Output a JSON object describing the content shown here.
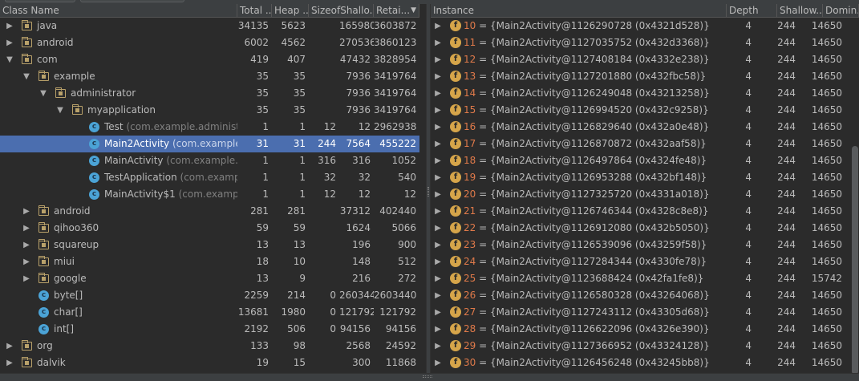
{
  "class_table": {
    "columns": [
      "Class Name",
      "Total ...",
      "Heap ...",
      "SizeofShallo...",
      "Retai..."
    ],
    "rows": [
      {
        "name": "java",
        "pkg": "",
        "kind": "package",
        "depth": 0,
        "expanded": false,
        "total": "34135",
        "heap": "5623",
        "sizeof": "",
        "shallow": "165980",
        "retained": "3603872",
        "selected": false
      },
      {
        "name": "android",
        "pkg": "",
        "kind": "package",
        "depth": 0,
        "expanded": false,
        "total": "6002",
        "heap": "4562",
        "sizeof": "",
        "shallow": "270536",
        "retained": "3860123",
        "selected": false
      },
      {
        "name": "com",
        "pkg": "",
        "kind": "package",
        "depth": 0,
        "expanded": true,
        "total": "419",
        "heap": "407",
        "sizeof": "",
        "shallow": "47432",
        "retained": "3828954",
        "selected": false
      },
      {
        "name": "example",
        "pkg": "",
        "kind": "package",
        "depth": 1,
        "expanded": true,
        "total": "35",
        "heap": "35",
        "sizeof": "",
        "shallow": "7936",
        "retained": "3419764",
        "selected": false
      },
      {
        "name": "administrator",
        "pkg": "",
        "kind": "package",
        "depth": 2,
        "expanded": true,
        "total": "35",
        "heap": "35",
        "sizeof": "",
        "shallow": "7936",
        "retained": "3419764",
        "selected": false
      },
      {
        "name": "myapplication",
        "pkg": "",
        "kind": "package",
        "depth": 3,
        "expanded": true,
        "total": "35",
        "heap": "35",
        "sizeof": "",
        "shallow": "7936",
        "retained": "3419764",
        "selected": false
      },
      {
        "name": "Test",
        "pkg": "(com.example.administra",
        "kind": "class",
        "depth": 4,
        "expanded": null,
        "total": "1",
        "heap": "1",
        "sizeof": "12",
        "shallow": "12",
        "retained": "2962938",
        "selected": false
      },
      {
        "name": "Main2Activity",
        "pkg": "(com.example.a",
        "kind": "class",
        "depth": 4,
        "expanded": null,
        "total": "31",
        "heap": "31",
        "sizeof": "244",
        "shallow": "7564",
        "retained": "455222",
        "selected": true
      },
      {
        "name": "MainActivity",
        "pkg": "(com.example.ac",
        "kind": "class",
        "depth": 4,
        "expanded": null,
        "total": "1",
        "heap": "1",
        "sizeof": "316",
        "shallow": "316",
        "retained": "1052",
        "selected": false
      },
      {
        "name": "TestApplication",
        "pkg": "(com.exampl",
        "kind": "class",
        "depth": 4,
        "expanded": null,
        "total": "1",
        "heap": "1",
        "sizeof": "32",
        "shallow": "32",
        "retained": "540",
        "selected": false
      },
      {
        "name": "MainActivity$1",
        "pkg": "(com.example",
        "kind": "class",
        "depth": 4,
        "expanded": null,
        "total": "1",
        "heap": "1",
        "sizeof": "12",
        "shallow": "12",
        "retained": "12",
        "selected": false
      },
      {
        "name": "android",
        "pkg": "",
        "kind": "package",
        "depth": 1,
        "expanded": false,
        "total": "281",
        "heap": "281",
        "sizeof": "",
        "shallow": "37312",
        "retained": "402440",
        "selected": false
      },
      {
        "name": "qihoo360",
        "pkg": "",
        "kind": "package",
        "depth": 1,
        "expanded": false,
        "total": "59",
        "heap": "59",
        "sizeof": "",
        "shallow": "1624",
        "retained": "5066",
        "selected": false
      },
      {
        "name": "squareup",
        "pkg": "",
        "kind": "package",
        "depth": 1,
        "expanded": false,
        "total": "13",
        "heap": "13",
        "sizeof": "",
        "shallow": "196",
        "retained": "900",
        "selected": false
      },
      {
        "name": "miui",
        "pkg": "",
        "kind": "package",
        "depth": 1,
        "expanded": false,
        "total": "18",
        "heap": "10",
        "sizeof": "",
        "shallow": "148",
        "retained": "512",
        "selected": false
      },
      {
        "name": "google",
        "pkg": "",
        "kind": "package",
        "depth": 1,
        "expanded": false,
        "total": "13",
        "heap": "9",
        "sizeof": "",
        "shallow": "216",
        "retained": "272",
        "selected": false
      },
      {
        "name": "byte[]",
        "pkg": "",
        "kind": "class",
        "depth": 1,
        "expanded": null,
        "total": "2259",
        "heap": "214",
        "sizeof": "0",
        "shallow": "260344",
        "retained": "2603440",
        "selected": false
      },
      {
        "name": "char[]",
        "pkg": "",
        "kind": "class",
        "depth": 1,
        "expanded": null,
        "total": "13681",
        "heap": "1980",
        "sizeof": "0",
        "shallow": "121792",
        "retained": "121792",
        "selected": false
      },
      {
        "name": "int[]",
        "pkg": "",
        "kind": "class",
        "depth": 1,
        "expanded": null,
        "total": "2192",
        "heap": "506",
        "sizeof": "0",
        "shallow": "94156",
        "retained": "94156",
        "selected": false
      },
      {
        "name": "org",
        "pkg": "",
        "kind": "package",
        "depth": 0,
        "expanded": false,
        "total": "133",
        "heap": "98",
        "sizeof": "",
        "shallow": "2568",
        "retained": "24592",
        "selected": false
      },
      {
        "name": "dalvik",
        "pkg": "",
        "kind": "package",
        "depth": 0,
        "expanded": false,
        "total": "19",
        "heap": "15",
        "sizeof": "",
        "shallow": "300",
        "retained": "11868",
        "selected": false
      }
    ]
  },
  "instance_table": {
    "columns": [
      "Instance",
      "Depth",
      "Shallow...",
      "Domin..."
    ],
    "rows": [
      {
        "index": "10",
        "label": "{Main2Activity@1126290728 (0x4321d528)}",
        "depth": "4",
        "shallow": "244",
        "dominating": "14650"
      },
      {
        "index": "11",
        "label": "{Main2Activity@1127035752 (0x432d3368)}",
        "depth": "4",
        "shallow": "244",
        "dominating": "14650"
      },
      {
        "index": "12",
        "label": "{Main2Activity@1127408184 (0x4332e238)}",
        "depth": "4",
        "shallow": "244",
        "dominating": "14650"
      },
      {
        "index": "13",
        "label": "{Main2Activity@1127201880 (0x432fbc58)}",
        "depth": "4",
        "shallow": "244",
        "dominating": "14650"
      },
      {
        "index": "14",
        "label": "{Main2Activity@1126249048 (0x43213258)}",
        "depth": "4",
        "shallow": "244",
        "dominating": "14650"
      },
      {
        "index": "15",
        "label": "{Main2Activity@1126994520 (0x432c9258)}",
        "depth": "4",
        "shallow": "244",
        "dominating": "14650"
      },
      {
        "index": "16",
        "label": "{Main2Activity@1126829640 (0x432a0e48)}",
        "depth": "4",
        "shallow": "244",
        "dominating": "14650"
      },
      {
        "index": "17",
        "label": "{Main2Activity@1126870872 (0x432aaf58)}",
        "depth": "4",
        "shallow": "244",
        "dominating": "14650"
      },
      {
        "index": "18",
        "label": "{Main2Activity@1126497864 (0x4324fe48)}",
        "depth": "4",
        "shallow": "244",
        "dominating": "14650"
      },
      {
        "index": "19",
        "label": "{Main2Activity@1126953288 (0x432bf148)}",
        "depth": "4",
        "shallow": "244",
        "dominating": "14650"
      },
      {
        "index": "20",
        "label": "{Main2Activity@1127325720 (0x4331a018)}",
        "depth": "4",
        "shallow": "244",
        "dominating": "14650"
      },
      {
        "index": "21",
        "label": "{Main2Activity@1126746344 (0x4328c8e8)}",
        "depth": "4",
        "shallow": "244",
        "dominating": "14650"
      },
      {
        "index": "22",
        "label": "{Main2Activity@1126912080 (0x432b5050)}",
        "depth": "4",
        "shallow": "244",
        "dominating": "14650"
      },
      {
        "index": "23",
        "label": "{Main2Activity@1126539096 (0x43259f58)}",
        "depth": "4",
        "shallow": "244",
        "dominating": "14650"
      },
      {
        "index": "24",
        "label": "{Main2Activity@1127284344 (0x4330fe78)}",
        "depth": "4",
        "shallow": "244",
        "dominating": "14650"
      },
      {
        "index": "25",
        "label": "{Main2Activity@1123688424 (0x42fa1fe8)}",
        "depth": "4",
        "shallow": "244",
        "dominating": "15742"
      },
      {
        "index": "26",
        "label": "{Main2Activity@1126580328 (0x43264068)}",
        "depth": "4",
        "shallow": "244",
        "dominating": "14650"
      },
      {
        "index": "27",
        "label": "{Main2Activity@1127243112 (0x43305d68)}",
        "depth": "4",
        "shallow": "244",
        "dominating": "14650"
      },
      {
        "index": "28",
        "label": "{Main2Activity@1126622096 (0x4326e390)}",
        "depth": "4",
        "shallow": "244",
        "dominating": "14650"
      },
      {
        "index": "29",
        "label": "{Main2Activity@1127366952 (0x43324128)}",
        "depth": "4",
        "shallow": "244",
        "dominating": "14650"
      },
      {
        "index": "30",
        "label": "{Main2Activity@1126456248 (0x43245bb8)}",
        "depth": "4",
        "shallow": "244",
        "dominating": "14650"
      }
    ]
  },
  "colors": {
    "background": "#2b2b2b",
    "header": "#3c3f41",
    "selection": "#4b6eaf",
    "package_icon": "#b9a16a",
    "class_icon": "#4ba3d6",
    "field_icon": "#d6a54a",
    "instance_index": "#e07a4a"
  },
  "icons": {
    "package": "package-icon",
    "class": "class-icon",
    "instance": "field-icon",
    "collapsed": "chevron-right-icon",
    "expanded": "chevron-down-icon",
    "sort": "sort-desc-icon"
  }
}
